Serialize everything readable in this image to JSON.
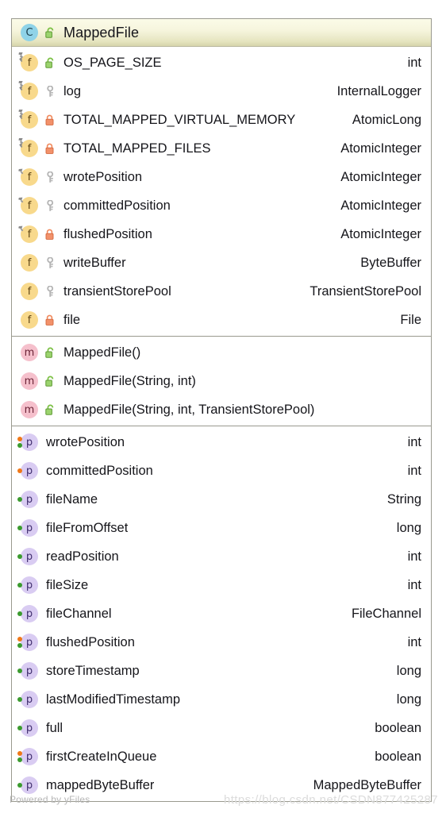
{
  "diagram": {
    "kind": "uml-class-node",
    "colors": {
      "header_gradient_top": "#fbfbe8",
      "header_gradient_bottom": "#d6d5ab",
      "border": "#9a9a8f",
      "class_badge": "#8fd3e8",
      "field_badge": "#f8d98c",
      "method_badge": "#f5c0cc",
      "property_badge": "#d9ccf2",
      "public_lock": "#7bc043",
      "private_key": "#b4b4b4",
      "protected_lock": "#f08a5d",
      "setter_dot": "#f07818",
      "getter_dot": "#3b9b2f"
    },
    "header": {
      "class_icon": "class-badge-icon",
      "visibility_icon": "public-unlocked-padlock-icon",
      "name": "MappedFile"
    },
    "fields": [
      {
        "icon": "static-field-icon",
        "visibility_icon": "public-unlocked-padlock-icon",
        "name": "OS_PAGE_SIZE",
        "type": "int"
      },
      {
        "icon": "static-field-icon",
        "visibility_icon": "private-key-icon",
        "name": "log",
        "type": "InternalLogger"
      },
      {
        "icon": "static-field-icon",
        "visibility_icon": "protected-locked-padlock-icon",
        "name": "TOTAL_MAPPED_VIRTUAL_MEMORY",
        "type": "AtomicLong"
      },
      {
        "icon": "static-field-icon",
        "visibility_icon": "protected-locked-padlock-icon",
        "name": "TOTAL_MAPPED_FILES",
        "type": "AtomicInteger"
      },
      {
        "icon": "volatile-field-icon",
        "visibility_icon": "private-key-icon",
        "name": "wrotePosition",
        "type": "AtomicInteger"
      },
      {
        "icon": "volatile-field-icon",
        "visibility_icon": "private-key-icon",
        "name": "committedPosition",
        "type": "AtomicInteger"
      },
      {
        "icon": "volatile-field-icon",
        "visibility_icon": "protected-locked-padlock-icon",
        "name": "flushedPosition",
        "type": "AtomicInteger"
      },
      {
        "icon": "field-icon",
        "visibility_icon": "private-key-icon",
        "name": "writeBuffer",
        "type": "ByteBuffer"
      },
      {
        "icon": "field-icon",
        "visibility_icon": "private-key-icon",
        "name": "transientStorePool",
        "type": "TransientStorePool"
      },
      {
        "icon": "field-icon",
        "visibility_icon": "protected-locked-padlock-icon",
        "name": "file",
        "type": "File"
      }
    ],
    "methods": [
      {
        "icon": "method-icon",
        "visibility_icon": "public-unlocked-padlock-icon",
        "name": "MappedFile()",
        "type": ""
      },
      {
        "icon": "method-icon",
        "visibility_icon": "public-unlocked-padlock-icon",
        "name": "MappedFile(String, int)",
        "type": ""
      },
      {
        "icon": "method-icon",
        "visibility_icon": "public-unlocked-padlock-icon",
        "name": "MappedFile(String, int, TransientStorePool)",
        "type": ""
      }
    ],
    "properties": [
      {
        "icon": "property-icon",
        "accessors": [
          "setter",
          "getter"
        ],
        "name": "wrotePosition",
        "type": "int"
      },
      {
        "icon": "property-icon",
        "accessors": [
          "setter"
        ],
        "name": "committedPosition",
        "type": "int"
      },
      {
        "icon": "property-icon",
        "accessors": [
          "getter"
        ],
        "name": "fileName",
        "type": "String"
      },
      {
        "icon": "property-icon",
        "accessors": [
          "getter"
        ],
        "name": "fileFromOffset",
        "type": "long"
      },
      {
        "icon": "property-icon",
        "accessors": [
          "getter"
        ],
        "name": "readPosition",
        "type": "int"
      },
      {
        "icon": "property-icon",
        "accessors": [
          "getter"
        ],
        "name": "fileSize",
        "type": "int"
      },
      {
        "icon": "property-icon",
        "accessors": [
          "getter"
        ],
        "name": "fileChannel",
        "type": "FileChannel"
      },
      {
        "icon": "property-icon",
        "accessors": [
          "setter",
          "getter"
        ],
        "name": "flushedPosition",
        "type": "int"
      },
      {
        "icon": "property-icon",
        "accessors": [
          "getter"
        ],
        "name": "storeTimestamp",
        "type": "long"
      },
      {
        "icon": "property-icon",
        "accessors": [
          "getter"
        ],
        "name": "lastModifiedTimestamp",
        "type": "long"
      },
      {
        "icon": "property-icon",
        "accessors": [
          "getter"
        ],
        "name": "full",
        "type": "boolean"
      },
      {
        "icon": "property-icon",
        "accessors": [
          "setter",
          "getter"
        ],
        "name": "firstCreateInQueue",
        "type": "boolean"
      },
      {
        "icon": "property-icon",
        "accessors": [
          "getter"
        ],
        "name": "mappedByteBuffer",
        "type": "MappedByteBuffer"
      }
    ]
  },
  "footer": {
    "powered_by": "Powered by yFiles",
    "watermark_url": "https://blog.csdn.net/CSDN877425287"
  }
}
